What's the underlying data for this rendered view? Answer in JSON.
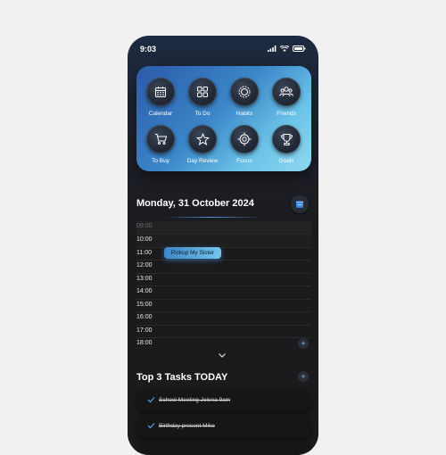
{
  "status_bar": {
    "time": "9:03"
  },
  "apps": [
    {
      "label": "Calendar",
      "icon": "calendar-icon"
    },
    {
      "label": "To Do",
      "icon": "grid-icon"
    },
    {
      "label": "Habits",
      "icon": "habit-ring-icon"
    },
    {
      "label": "Friends",
      "icon": "friends-icon"
    },
    {
      "label": "To Buy",
      "icon": "cart-icon"
    },
    {
      "label": "Day Review",
      "icon": "star-icon"
    },
    {
      "label": "Focus",
      "icon": "focus-target-icon"
    },
    {
      "label": "Goals",
      "icon": "trophy-icon"
    }
  ],
  "schedule": {
    "date_title": "Monday, 31 October 2024",
    "times": [
      "09:00",
      "10:00",
      "11:00",
      "12:00",
      "13:00",
      "14:00",
      "15:00",
      "16:00",
      "17:00",
      "18:00"
    ],
    "event": {
      "title": "Pickup My Sister",
      "time": "11:00"
    }
  },
  "tasks": {
    "title": "Top 3 Tasks TODAY",
    "items": [
      {
        "text": "School Meeting Jelena 9am",
        "done": true
      },
      {
        "text": "Birthday present Mike",
        "done": true
      }
    ]
  },
  "colors": {
    "accent": "#5aaee0",
    "background": "#1b1b1d"
  }
}
